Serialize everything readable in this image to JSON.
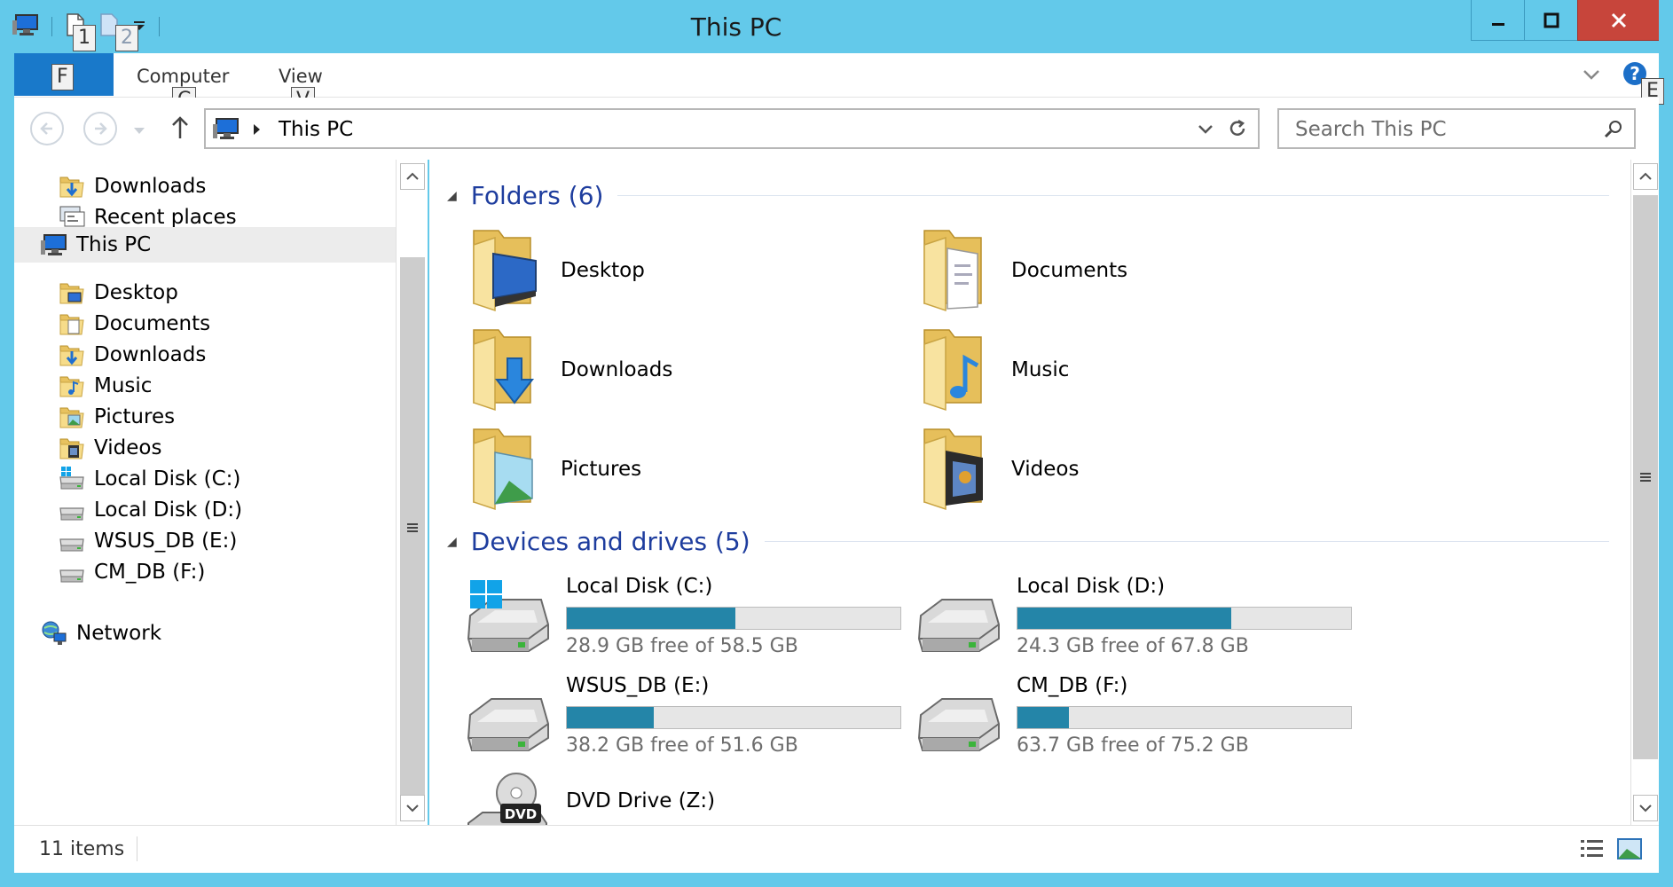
{
  "window": {
    "title": "This PC",
    "controls": {
      "minimize": "minimize",
      "maximize": "maximize",
      "close": "close"
    }
  },
  "key_tips": {
    "qat1": "1",
    "qat2": "2",
    "file": "F",
    "computer": "C",
    "view": "V",
    "help": "E"
  },
  "ribbon": {
    "tabs": [
      "Computer",
      "View"
    ]
  },
  "address_bar": {
    "path": "This PC"
  },
  "search": {
    "placeholder": "Search This PC"
  },
  "nav": {
    "quick": [
      {
        "label": "Downloads",
        "icon": "downloads-folder-icon"
      },
      {
        "label": "Recent places",
        "icon": "recent-places-icon"
      }
    ],
    "this_pc": {
      "label": "This PC",
      "icon": "computer-icon"
    },
    "children": [
      {
        "label": "Desktop",
        "icon": "desktop-folder-icon"
      },
      {
        "label": "Documents",
        "icon": "documents-folder-icon"
      },
      {
        "label": "Downloads",
        "icon": "downloads-folder-icon"
      },
      {
        "label": "Music",
        "icon": "music-folder-icon"
      },
      {
        "label": "Pictures",
        "icon": "pictures-folder-icon"
      },
      {
        "label": "Videos",
        "icon": "videos-folder-icon"
      },
      {
        "label": "Local Disk (C:)",
        "icon": "system-drive-icon"
      },
      {
        "label": "Local Disk (D:)",
        "icon": "drive-icon"
      },
      {
        "label": "WSUS_DB (E:)",
        "icon": "drive-icon"
      },
      {
        "label": "CM_DB (F:)",
        "icon": "drive-icon"
      }
    ],
    "network": {
      "label": "Network",
      "icon": "network-icon"
    }
  },
  "content": {
    "folders_header": "Folders (6)",
    "folders": [
      {
        "name": "Desktop",
        "icon": "desktop-folder-icon"
      },
      {
        "name": "Documents",
        "icon": "documents-folder-icon"
      },
      {
        "name": "Downloads",
        "icon": "downloads-folder-icon"
      },
      {
        "name": "Music",
        "icon": "music-folder-icon"
      },
      {
        "name": "Pictures",
        "icon": "pictures-folder-icon"
      },
      {
        "name": "Videos",
        "icon": "videos-folder-icon"
      }
    ],
    "drives_header": "Devices and drives (5)",
    "drives": [
      {
        "name": "Local Disk (C:)",
        "free": "28.9 GB free of 58.5 GB",
        "used_fraction": 0.506,
        "icon": "system-drive-icon"
      },
      {
        "name": "Local Disk (D:)",
        "free": "24.3 GB free of 67.8 GB",
        "used_fraction": 0.642,
        "icon": "drive-icon"
      },
      {
        "name": "WSUS_DB (E:)",
        "free": "38.2 GB free of 51.6 GB",
        "used_fraction": 0.26,
        "icon": "drive-icon"
      },
      {
        "name": "CM_DB (F:)",
        "free": "63.7 GB free of 75.2 GB",
        "used_fraction": 0.153,
        "icon": "drive-icon"
      }
    ],
    "dvd": {
      "name": "DVD Drive (Z:)",
      "icon": "dvd-drive-icon",
      "badge": "DVD"
    }
  },
  "status_bar": {
    "items": "11 items"
  },
  "colors": {
    "frame": "#63c9ea",
    "file_tab": "#1979ca",
    "drive_bar": "#2485a8",
    "group_title": "#1e3d9e",
    "close": "#c7453b"
  }
}
